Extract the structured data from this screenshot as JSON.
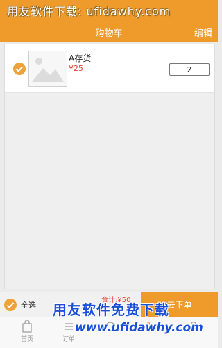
{
  "watermark": {
    "top": "用友软件下载: ufidawhy.com",
    "bottom_line1": "用友软件免费下载",
    "bottom_line2": "www.ufidawhy.com"
  },
  "header": {
    "title": "购物车",
    "edit_label": "编辑"
  },
  "cart": {
    "items": [
      {
        "name": "A存货",
        "price": "¥25",
        "quantity": "2",
        "checked": true,
        "thumbnail_icon": "image-placeholder-icon"
      }
    ]
  },
  "footer": {
    "select_all_label": "全选",
    "total_label": "合计:¥50",
    "checkout_label": "去下单"
  },
  "tabbar": {
    "items": [
      {
        "label": "首页",
        "icon": "home-bag-icon"
      },
      {
        "label": "订单",
        "icon": "list-icon"
      },
      {
        "label": "",
        "icon": "circle-icon"
      },
      {
        "label": "",
        "icon": "cart-icon"
      },
      {
        "label": "",
        "icon": "user-icon"
      }
    ]
  },
  "colors": {
    "brand_orange": "#ef9b2c",
    "price_red": "#e0473a"
  }
}
